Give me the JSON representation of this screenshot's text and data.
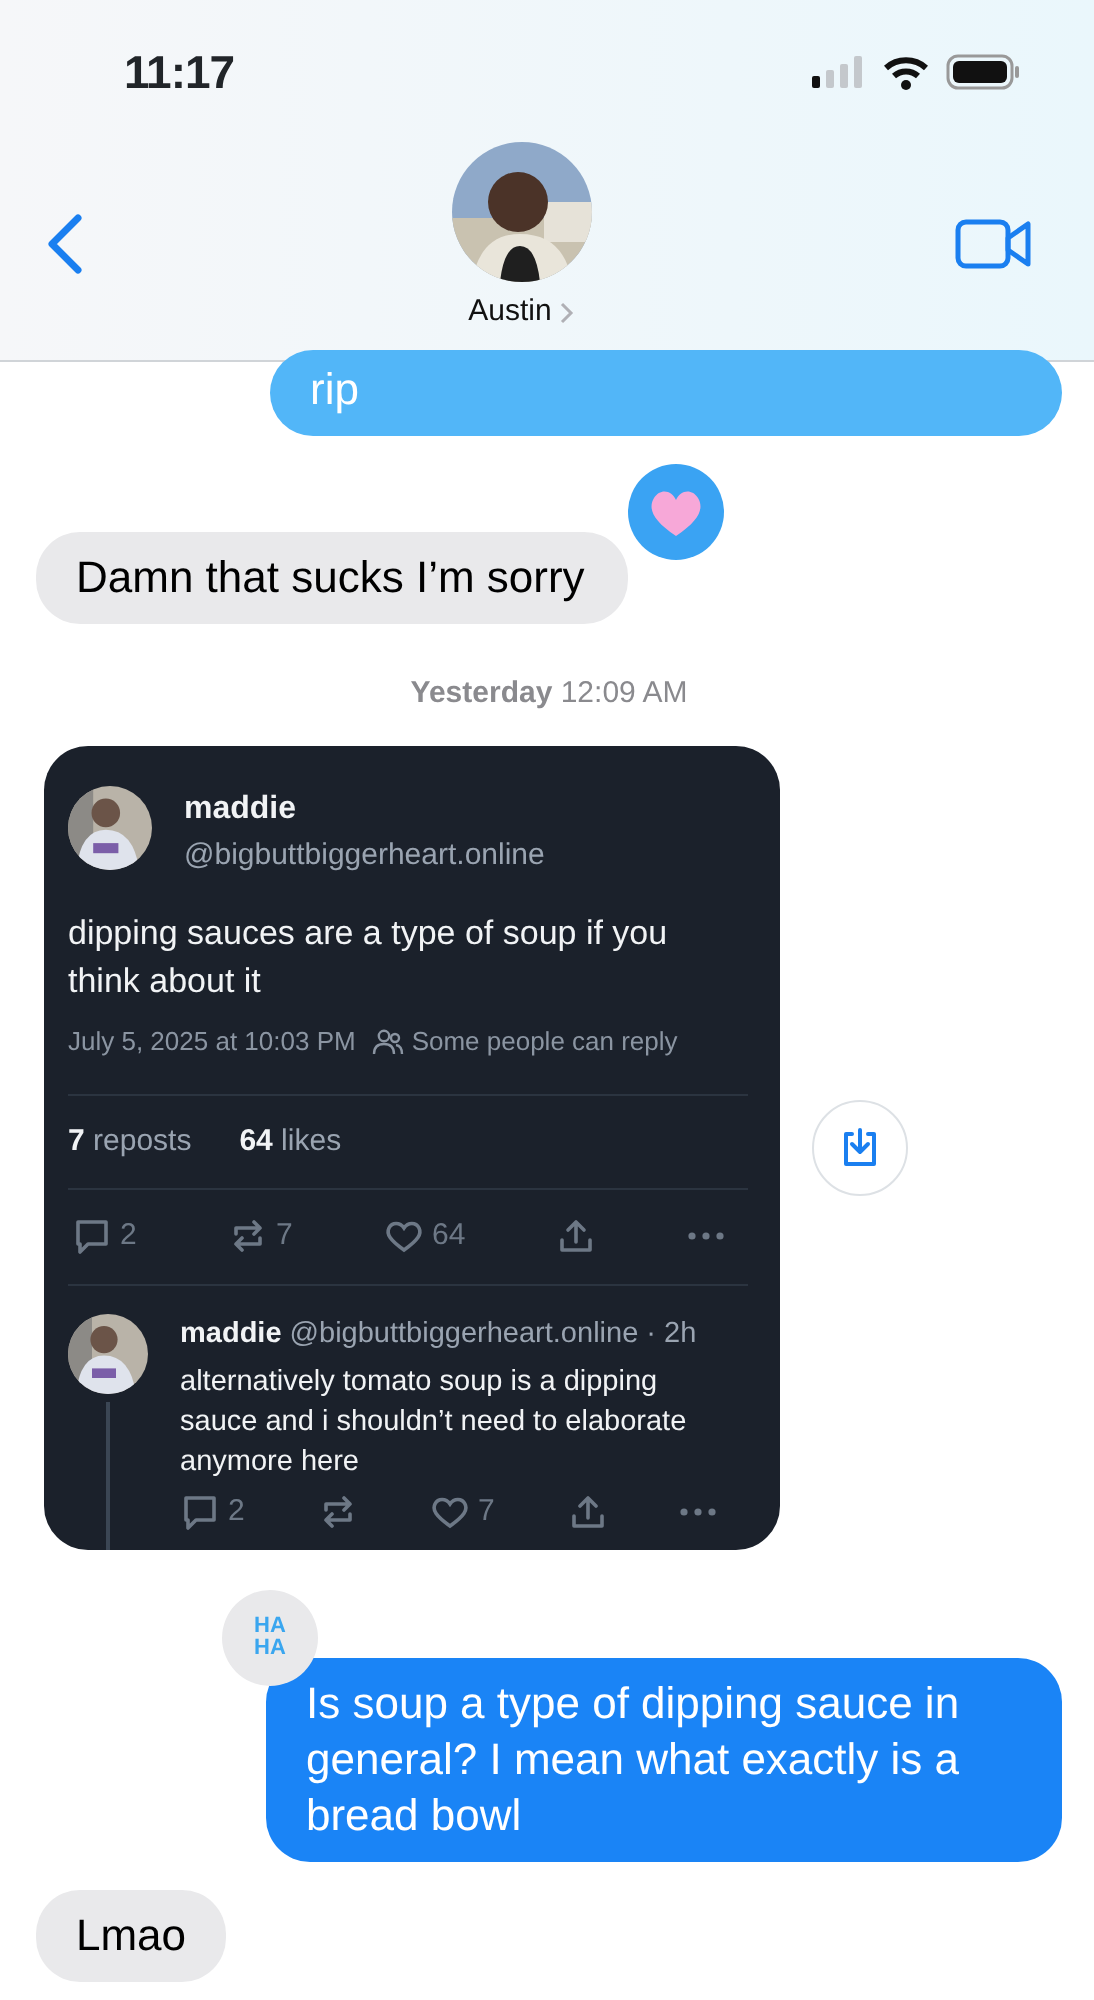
{
  "status_bar": {
    "time": "11:17"
  },
  "header": {
    "contact_name": "Austin"
  },
  "messages": [
    {
      "kind": "sent",
      "text": "rip",
      "color": "#52b6f8"
    },
    {
      "kind": "received",
      "text": "Damn that sucks I’m sorry",
      "reaction": {
        "kind": "heart"
      }
    },
    {
      "kind": "timestamp",
      "text": "**Yesterday** 12:09 AM"
    },
    {
      "kind": "post",
      "author": "maddie",
      "handle": "@bigbuttbiggerheart.online",
      "text": "dipping sauces are a type of soup if you think about it",
      "date": "July 5, 2025 at 10:03 PM",
      "audience": "Some people can reply",
      "stats": [
        "**7** reposts",
        "**64** likes"
      ],
      "actions": [
        {
          "kind": "comment",
          "count": "2"
        },
        {
          "kind": "repost",
          "count": "7"
        },
        {
          "kind": "like",
          "count": "64"
        },
        {
          "kind": "share"
        },
        {
          "kind": "more"
        }
      ],
      "reply": {
        "author": "maddie",
        "handle": "@bigbuttbiggerheart.online · 2h",
        "text": "alternatively tomato soup is a dipping sauce and i shouldn’t need to elaborate anymore here",
        "actions": [
          {
            "kind": "comment",
            "count": "2"
          },
          {
            "kind": "repost"
          },
          {
            "kind": "like",
            "count": "7"
          },
          {
            "kind": "share"
          },
          {
            "kind": "more"
          }
        ]
      }
    },
    {
      "kind": "sent",
      "text": "Is soup a type of dipping sauce in general? I mean what exactly is a bread bowl",
      "color": "#1a84f6",
      "reaction": {
        "kind": "haha",
        "label": "HA HA"
      }
    },
    {
      "kind": "received",
      "text": "Lmao"
    }
  ]
}
